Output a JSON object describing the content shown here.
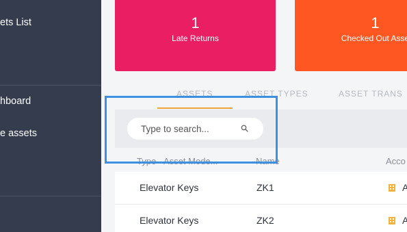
{
  "sidebar": {
    "items": [
      {
        "label": "ets List"
      },
      {
        "label": "hboard"
      },
      {
        "label": "e assets"
      }
    ]
  },
  "kpis": [
    {
      "value": "1",
      "label": "Late Returns",
      "color": "#e91e63"
    },
    {
      "value": "1",
      "label": "Checked Out Asse",
      "color": "#ff5722"
    }
  ],
  "tabs": [
    {
      "label": "ASSETS",
      "active": true
    },
    {
      "label": "ASSET TYPES"
    },
    {
      "label": "ASSET TRANS"
    }
  ],
  "search": {
    "placeholder": "Type to search..."
  },
  "table": {
    "columns": [
      "Type - Asset Mode...",
      "Name",
      "Acco"
    ],
    "rows": [
      {
        "type": "Elevator Keys",
        "name": "ZK1",
        "account": "A"
      },
      {
        "type": "Elevator Keys",
        "name": "ZK2",
        "account": "A"
      }
    ]
  },
  "colors": {
    "sidebar": "#343c4e",
    "accent_tab": "#f0a23b",
    "highlight": "#3d8fe0"
  },
  "icons": {
    "search": "search-icon",
    "account": "building-icon"
  }
}
